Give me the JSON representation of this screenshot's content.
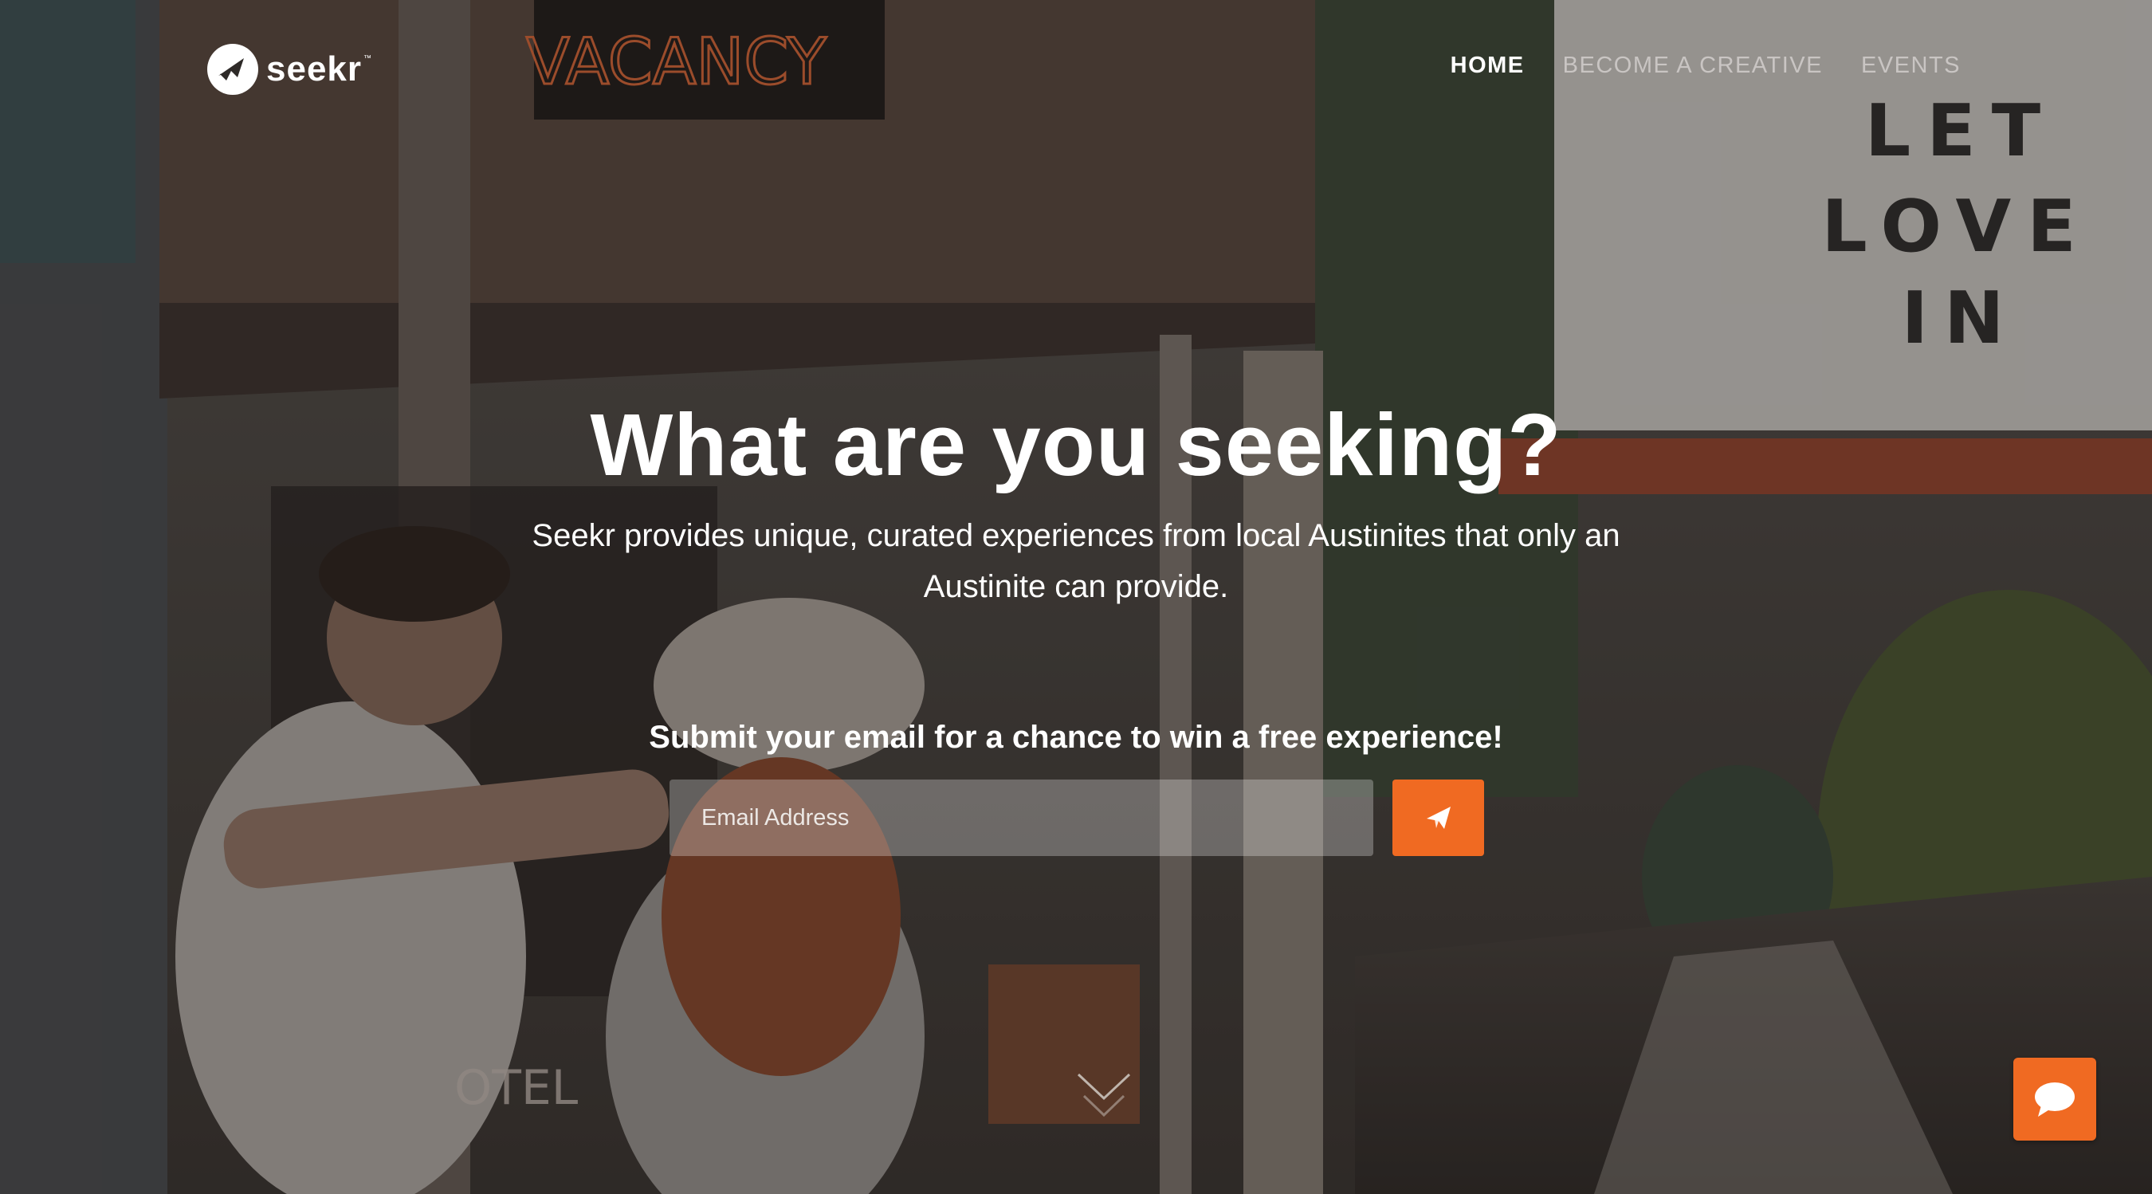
{
  "brand": {
    "name": "seekr",
    "tm": "™"
  },
  "nav": {
    "items": [
      {
        "label": "HOME"
      },
      {
        "label": "BECOME A CREATIVE"
      },
      {
        "label": "EVENTS"
      }
    ]
  },
  "hero": {
    "title": "What are you seeking?",
    "subtitle": "Seekr provides unique, curated experiences from local Austinites that only an Austinite can provide.",
    "email_prompt": "Submit your email for a chance to win a free experience!",
    "email_placeholder": "Email Address"
  },
  "background": {
    "sign_top": "VACANCY",
    "marquee": [
      "LET",
      "LOVE",
      "IN"
    ],
    "motel_sign": "OTEL"
  },
  "colors": {
    "accent": "#f06a22",
    "text": "#ffffff",
    "nav_inactive": "#c9c5c3"
  },
  "icons": {
    "submit": "paper-plane-icon",
    "scroll": "chevron-down-icon",
    "chat": "chat-bubble-icon"
  }
}
